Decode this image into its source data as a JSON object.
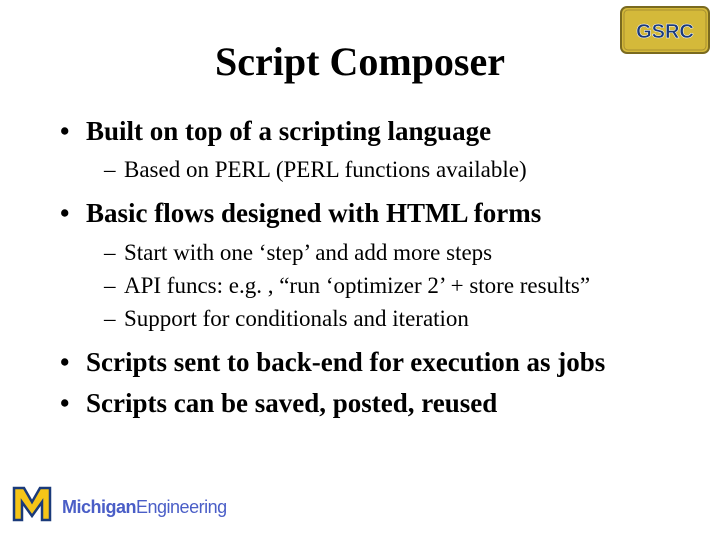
{
  "title": "Script Composer",
  "bullets": [
    {
      "text": "Built on top of a scripting language",
      "sub": [
        "Based on PERL (PERL functions available)"
      ]
    },
    {
      "text": "Basic flows designed with HTML forms",
      "sub": [
        "Start with one ‘step’ and add more steps",
        "API funcs: e.g. , “run ‘optimizer 2’ + store results”",
        "Support for conditionals and iteration"
      ]
    },
    {
      "text": "Scripts sent to back-end for execution as jobs",
      "sub": []
    },
    {
      "text": "Scripts can be saved, posted, reused",
      "sub": []
    }
  ],
  "footer": {
    "brand_bold": "Michigan",
    "brand_light": "Engineering"
  },
  "logos": {
    "gsrc": "GSRC"
  }
}
